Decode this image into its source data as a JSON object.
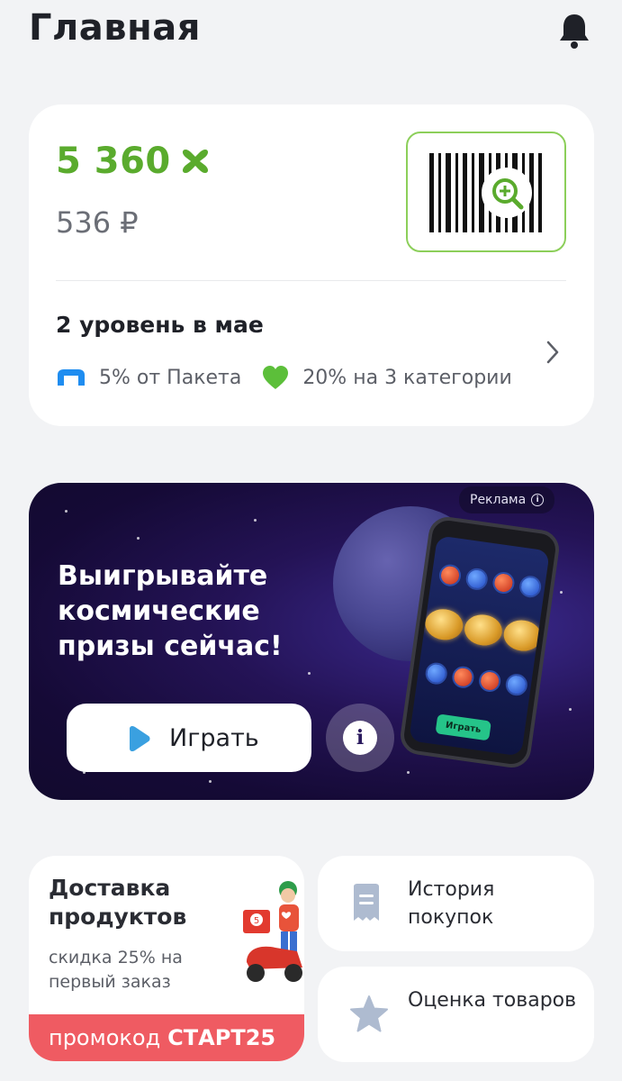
{
  "header": {
    "title": "Главная",
    "bell_icon": "bell-icon"
  },
  "balance": {
    "points": "5 360",
    "points_icon": "x-points-icon",
    "rubles": "536 ₽",
    "barcode_icon": "barcode-zoom-icon",
    "level_title": "2 уровень в мае",
    "perks": [
      {
        "icon": "paket-logo-icon",
        "label": "5% от Пакета"
      },
      {
        "icon": "green-heart-icon",
        "label": "20% на 3 категории"
      }
    ],
    "accent_color": "#5aab2d"
  },
  "banner": {
    "ad_label": "Реклама",
    "title": "Выигрывайте космические призы сейчас!",
    "play_label": "Играть",
    "phone_button_label": "Играть"
  },
  "delivery": {
    "title": "Доставка продуктов",
    "subtitle": "скидка 25% на первый заказ",
    "promo_prefix": "промокод",
    "promo_code": "СТАРТ25",
    "promo_color": "#ef5b62"
  },
  "tiles": [
    {
      "label": "История покупок",
      "icon": "receipt-icon"
    },
    {
      "label": "Оценка товаров",
      "icon": "star-icon"
    }
  ]
}
